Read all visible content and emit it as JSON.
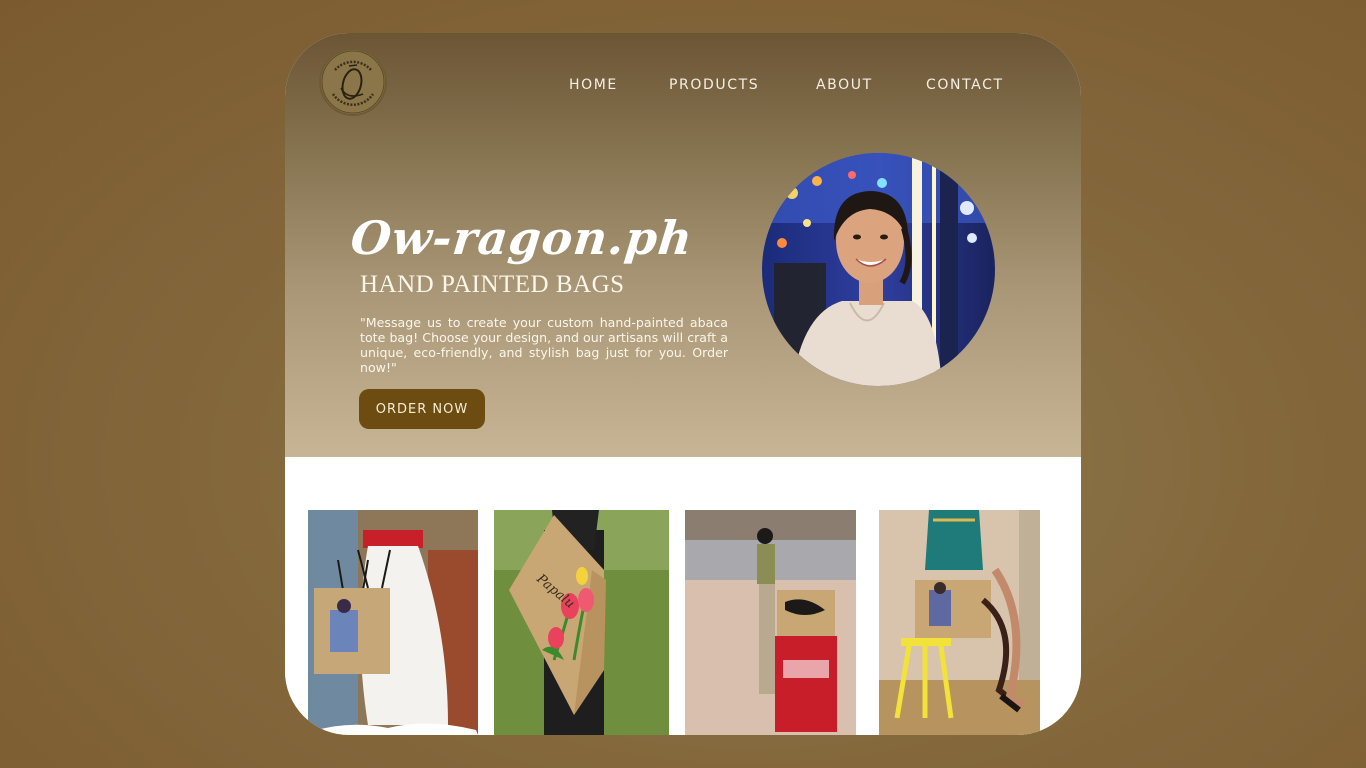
{
  "nav": {
    "items": [
      "HOME",
      "PRODUCTS",
      "ABOUT",
      "CONTACT"
    ]
  },
  "logo": {
    "ring_text_top": "OW-RAGON.PH",
    "ring_text_bottom": "HAND PAINTED BAGS"
  },
  "hero": {
    "title": "Ow-ragon.ph",
    "subtitle": "HAND PAINTED BAGS",
    "tagline": "\"Message us to create your custom hand-painted abaca tote bag! Choose your design, and our artisans will craft a unique, eco-friendly, and stylish bag just for you. Order now!\"",
    "cta_label": "ORDER NOW"
  },
  "gallery": {
    "photos": [
      {
        "alt": "person carrying painted tote bag"
      },
      {
        "alt": "tote bag painted with tulips"
      },
      {
        "alt": "traveler with painted tote at airport"
      },
      {
        "alt": "tote bag on stool"
      }
    ],
    "bag_lettering_2": "Papalu"
  },
  "colors": {
    "page_bg": "#84693d",
    "hero_top": "#6c5535",
    "hero_bottom": "#c7b596",
    "cta_bg": "#6d4c11",
    "nav_text": "#f4efe4"
  }
}
